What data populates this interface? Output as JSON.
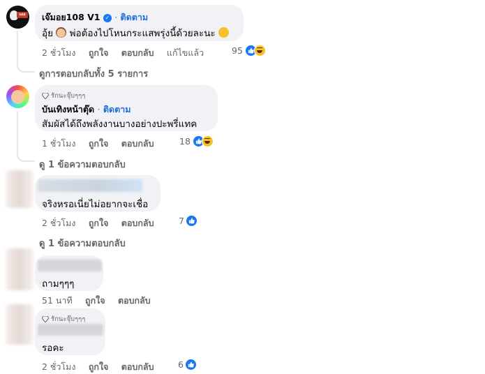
{
  "comments": [
    {
      "author": "เจ๊มอย108 V1",
      "follow_label": "ติดตาม",
      "text_prefix": "อุ้ย",
      "text": "พ่อต้องไปโหนกระแสพรุ่งนี้ด้วยละนะ",
      "time": "2 ชั่วโมง",
      "like_label": "ถูกใจ",
      "reply_label": "ตอบกลับ",
      "edited_label": "แก้ไขแล้ว",
      "reaction_count": "95",
      "view_replies": "ดูการตอบกลับทั้ง 5 รายการ",
      "avatar_text": "มอย"
    },
    {
      "badge": "รักนะจุ๊บๆๆๆ",
      "author": "บันเทิงหน้าตุ๊ด",
      "follow_label": "ติดตาม",
      "text": "สัมผัสได้ถึงพลังงานบางอย่างปะพรี่แทค",
      "time": "1 ชั่วโมง",
      "like_label": "ถูกใจ",
      "reply_label": "ตอบกลับ",
      "reaction_count": "18",
      "view_replies": "ดู 1 ข้อความตอบกลับ"
    },
    {
      "text": "จริงหรอเนี่ยไม่อยากจะเชื่อ",
      "time": "2 ชั่วโมง",
      "like_label": "ถูกใจ",
      "reply_label": "ตอบกลับ",
      "reaction_count": "7",
      "view_replies": "ดู 1 ข้อความตอบกลับ"
    },
    {
      "text": "ถามๆๆๆ",
      "time": "51 นาที",
      "like_label": "ถูกใจ",
      "reply_label": "ตอบกลับ"
    },
    {
      "badge": "รักนะจุ๊บๆๆๆ",
      "text": "รอคะ",
      "time": "2 ชั่วโมง",
      "like_label": "ถูกใจ",
      "reply_label": "ตอบกลับ",
      "reaction_count": "6"
    }
  ],
  "icons": {
    "like": "thumbs-up-icon",
    "haha": "haha-icon",
    "verified": "verified-badge-icon",
    "diamond": "diamond-icon"
  },
  "colors": {
    "link_blue": "#216fdb",
    "like_blue": "#1877f2",
    "bubble": "#f0f2f5",
    "meta_gray": "#65676b"
  }
}
